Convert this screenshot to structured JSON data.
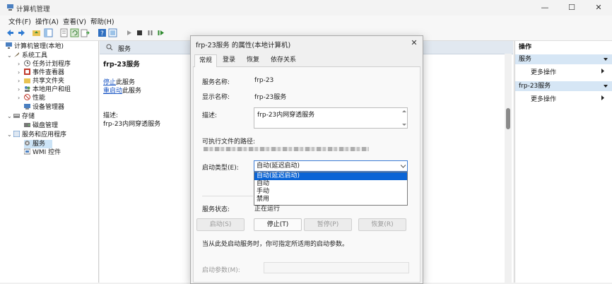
{
  "window": {
    "title": "计算机管理",
    "minimize": "—",
    "maximize": "☐",
    "close": "✕"
  },
  "menu": [
    "文件(F)",
    "操作(A)",
    "查看(V)",
    "帮助(H)"
  ],
  "tree": {
    "items": [
      {
        "label": "计算机管理(本地)",
        "chev": "",
        "level": 0
      },
      {
        "label": "系统工具",
        "chev": "⌄",
        "level": 1
      },
      {
        "label": "任务计划程序",
        "chev": "›",
        "level": 2
      },
      {
        "label": "事件查看器",
        "chev": "›",
        "level": 2
      },
      {
        "label": "共享文件夹",
        "chev": "›",
        "level": 2
      },
      {
        "label": "本地用户和组",
        "chev": "›",
        "level": 2
      },
      {
        "label": "性能",
        "chev": "›",
        "level": 2
      },
      {
        "label": "设备管理器",
        "chev": "",
        "level": 2
      },
      {
        "label": "存储",
        "chev": "⌄",
        "level": 1
      },
      {
        "label": "磁盘管理",
        "chev": "",
        "level": 2
      },
      {
        "label": "服务和应用程序",
        "chev": "⌄",
        "level": 1
      },
      {
        "label": "服务",
        "chev": "",
        "level": 2
      },
      {
        "label": "WMI 控件",
        "chev": "",
        "level": 2
      }
    ]
  },
  "middle": {
    "header": "服务",
    "service_name": "frp-23服务",
    "stop_link": "停止",
    "stop_suffix": "此服务",
    "restart_link": "重启动",
    "restart_suffix": "此服务",
    "desc_label": "描述:",
    "desc_value": "frp-23内网穿透服务"
  },
  "actions": {
    "header": "操作",
    "group1": "服务",
    "group1_more": "更多操作",
    "group2": "frp-23服务",
    "group2_more": "更多操作"
  },
  "dialog": {
    "title": "frp-23服务 的属性(本地计算机)",
    "close": "✕",
    "tabs": [
      "常规",
      "登录",
      "恢复",
      "依存关系"
    ],
    "service_name_label": "服务名称:",
    "service_name_value": "frp-23",
    "display_name_label": "显示名称:",
    "display_name_value": "frp-23服务",
    "description_label": "描述:",
    "description_value": "frp-23内网穿透服务",
    "path_label": "可执行文件的路径:",
    "startup_type_label": "启动类型(E):",
    "startup_type_value": "自动(延迟启动)",
    "startup_options": [
      "自动(延迟启动)",
      "自动",
      "手动",
      "禁用"
    ],
    "status_label": "服务状态:",
    "status_value": "正在运行",
    "buttons": {
      "start": "启动(S)",
      "stop": "停止(T)",
      "pause": "暂停(P)",
      "resume": "恢复(R)"
    },
    "hint": "当从此处启动服务时，你可指定所适用的启动参数。",
    "params_label": "启动参数(M):"
  },
  "colors": {
    "accent": "#0a64d6",
    "link": "#1a56c4",
    "selection": "#cce4f7"
  }
}
